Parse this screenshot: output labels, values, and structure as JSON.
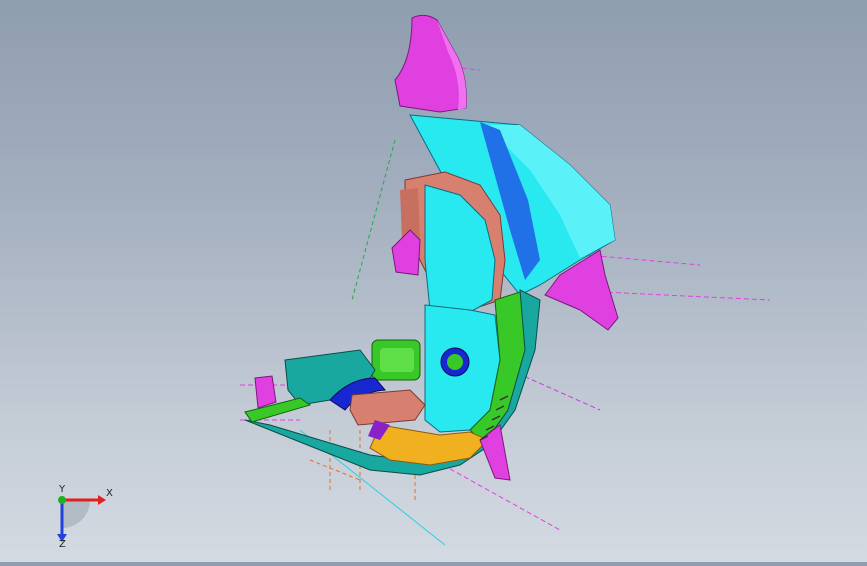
{
  "viewport": {
    "background_top": "#8f9db0",
    "background_bottom": "#d4dae2"
  },
  "model": {
    "part_colors": {
      "magenta": "#e040e0",
      "cyan": "#28e8f0",
      "blue": "#2070e8",
      "salmon": "#d88070",
      "green": "#38c828",
      "orange": "#f0b020",
      "teal": "#18a8a0",
      "dark_blue": "#1828d0",
      "purple": "#8a20c8"
    }
  },
  "triad": {
    "x_label": "X",
    "y_label": "Y",
    "z_label": "Z",
    "x_color": "#e02020",
    "y_color": "#20b020",
    "z_color": "#2040e0"
  }
}
